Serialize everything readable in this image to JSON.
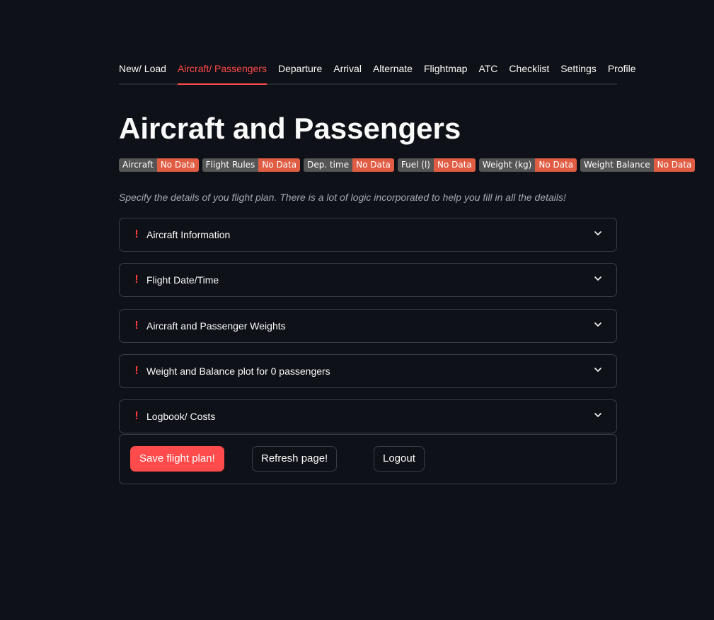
{
  "tabs": [
    {
      "label": "New/ Load",
      "active": false
    },
    {
      "label": "Aircraft/ Passengers",
      "active": true
    },
    {
      "label": "Departure",
      "active": false
    },
    {
      "label": "Arrival",
      "active": false
    },
    {
      "label": "Alternate",
      "active": false
    },
    {
      "label": "Flightmap",
      "active": false
    },
    {
      "label": "ATC",
      "active": false
    },
    {
      "label": "Checklist",
      "active": false
    },
    {
      "label": "Settings",
      "active": false
    },
    {
      "label": "Profile",
      "active": false
    }
  ],
  "page_title": "Aircraft and Passengers",
  "badges": [
    {
      "label": "Aircraft",
      "value": "No Data"
    },
    {
      "label": "Flight Rules",
      "value": "No Data"
    },
    {
      "label": "Dep. time",
      "value": "No Data"
    },
    {
      "label": "Fuel (l)",
      "value": "No Data"
    },
    {
      "label": "Weight (kg)",
      "value": "No Data"
    },
    {
      "label": "Weight Balance",
      "value": "No Data"
    }
  ],
  "caption": "Specify the details of you flight plan. There is a lot of logic incorporated to help you fill in all the details!",
  "expanders": [
    {
      "icon": "exclamation-icon",
      "label": "Aircraft Information"
    },
    {
      "icon": "exclamation-icon",
      "label": "Flight Date/Time"
    },
    {
      "icon": "exclamation-icon",
      "label": "Aircraft and Passenger Weights"
    },
    {
      "icon": "exclamation-icon",
      "label": "Weight and Balance plot for 0 passengers"
    },
    {
      "icon": "exclamation-icon",
      "label": "Logbook/ Costs"
    }
  ],
  "buttons": {
    "save": "Save flight plan!",
    "refresh": "Refresh page!",
    "logout": "Logout"
  },
  "colors": {
    "background": "#0e1117",
    "accent": "#ff4b4b",
    "badge_label": "#555555",
    "badge_value": "#e05d44"
  }
}
